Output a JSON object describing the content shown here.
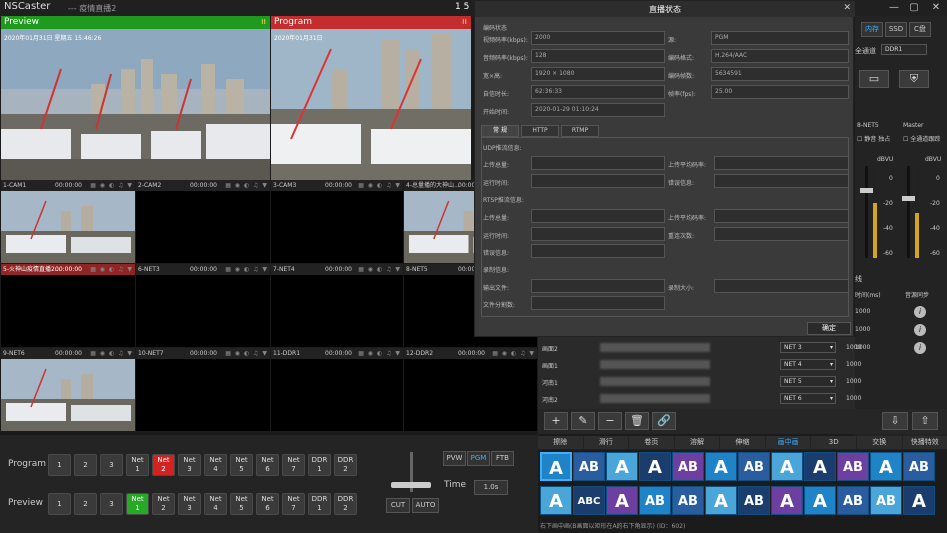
{
  "app": {
    "name": "NSCaster",
    "project": "--- 疫情直播2",
    "clock": "1 5"
  },
  "preview_panel": {
    "label": "Preview",
    "timestamp": "2020年01月31日  星期五  15:46:26"
  },
  "program_panel": {
    "label": "Program",
    "timestamp": "2020年01月31日"
  },
  "sources": [
    {
      "label": "1-CAM1",
      "time": "00:00:00",
      "state": "normal",
      "cam": true
    },
    {
      "label": "2-CAM2",
      "time": "00:00:00",
      "state": "normal",
      "cam": false
    },
    {
      "label": "3-CAM3",
      "time": "00:00:00",
      "state": "normal",
      "cam": false
    },
    {
      "label": "4-总量播的大神山...",
      "time": "00:00:00",
      "state": "normal",
      "cam": true
    },
    {
      "label": "5-火神山疫情直播2...",
      "time": "00:00:00",
      "state": "red",
      "cam": false
    },
    {
      "label": "6-NET3",
      "time": "00:00:00",
      "state": "normal",
      "cam": false
    },
    {
      "label": "7-NET4",
      "time": "00:00:00",
      "state": "normal",
      "cam": false
    },
    {
      "label": "8-NET5",
      "time": "00:00:00",
      "state": "normal",
      "cam": false
    },
    {
      "label": "9-NET6",
      "time": "00:00:00",
      "state": "normal",
      "cam": true
    },
    {
      "label": "10-NET7",
      "time": "00:00:00",
      "state": "normal",
      "cam": false
    },
    {
      "label": "11-DDR1",
      "time": "00:00:00",
      "state": "normal",
      "cam": false
    },
    {
      "label": "12-DDR2",
      "time": "00:00:00",
      "state": "normal",
      "cam": false
    }
  ],
  "switcher": {
    "program_label": "Program",
    "preview_label": "Preview",
    "buttons": [
      "1",
      "2",
      "3",
      "Net\n1",
      "Net\n2",
      "Net\n3",
      "Net\n4",
      "Net\n5",
      "Net\n6",
      "Net\n7",
      "DDR\n1",
      "DDR\n2"
    ],
    "program_active": 4,
    "preview_active": 3,
    "mode_buttons": [
      "PVW",
      "PGM",
      "FTB"
    ],
    "mode_active": 1,
    "time_label": "Time",
    "time_value": "1.0s",
    "cut": "CUT",
    "auto": "AUTO"
  },
  "dialog": {
    "title": "直播状态",
    "section_encode": "编码状态",
    "fields": [
      {
        "label": "视频码率(kbps):",
        "value": "2000"
      },
      {
        "label": "源:",
        "value": "PGM"
      },
      {
        "label": "音频码率(kbps):",
        "value": "128"
      },
      {
        "label": "编码格式:",
        "value": "H.264/AAC"
      },
      {
        "label": "宽×高:",
        "value": "1920 × 1080"
      },
      {
        "label": "编码帧数:",
        "value": "5634591"
      },
      {
        "label": "自信时长:",
        "value": "62:36:33"
      },
      {
        "label": "帧率(fps):",
        "value": "25.00"
      },
      {
        "label": "开始时间:",
        "value": "2020-01-29 01:10:24"
      }
    ],
    "tabs": [
      "常 规",
      "HTTP",
      "RTMP"
    ],
    "tab_active": 0,
    "udp_title": "UDP推流信息:",
    "rtsp_title": "RTSP推流信息:",
    "record_title": "录制信息:",
    "labels": {
      "upload_total": "上传总量:",
      "upload_avg": "上传平均码率:",
      "run_time": "运行时间:",
      "error_info": "错误信息:",
      "reconnect": "重连次数:",
      "output_file": "输出文件:",
      "record_size": "录制大小:",
      "file_split": "文件分割数:"
    },
    "ok": "确定"
  },
  "right_panel": {
    "storage": [
      "内存",
      "SSD",
      "C盘"
    ],
    "storage_active": 0,
    "all_channel": "全通道",
    "ddr": "DDR1",
    "net5": "8-NET5",
    "master": "Master",
    "mute": "静音",
    "solo": "独占",
    "all_follow": "全通道跟踪",
    "dbvu": "dBVU",
    "db_ticks": [
      "0",
      "-20",
      "-40",
      "-60"
    ],
    "line": "线",
    "time_ms": "时间(ms)",
    "sync": "音源同步",
    "latency": [
      "1000",
      "1000",
      "1000"
    ]
  },
  "stream_rows": [
    {
      "name": "画面2",
      "net": "NET 3",
      "ms": "1000"
    },
    {
      "name": "画面1",
      "net": "NET 4",
      "ms": "1000"
    },
    {
      "name": "河南1",
      "net": "NET 5",
      "ms": "1000"
    },
    {
      "name": "河南2",
      "net": "NET 6",
      "ms": "1000"
    }
  ],
  "toolbar": [
    "+",
    "✎",
    "−",
    "🗑",
    "🔗"
  ],
  "transition_tabs": [
    "擦除",
    "滑行",
    "卷页",
    "溶解",
    "伸缩",
    "画中画",
    "3D",
    "交换",
    "快播特效"
  ],
  "transition_active": 5,
  "thumbs": [
    "A",
    "AB",
    "A",
    "A",
    "AB",
    "A",
    "AB",
    "A",
    "A",
    "AB",
    "A",
    "AB",
    "A",
    "ABC",
    "A",
    "AB",
    "AB",
    "A",
    "AB",
    "A",
    "A",
    "AB",
    "AB",
    "A"
  ],
  "status_text": "右下画中画(B画面以矩形在A的右下角显示) (ID：602)"
}
